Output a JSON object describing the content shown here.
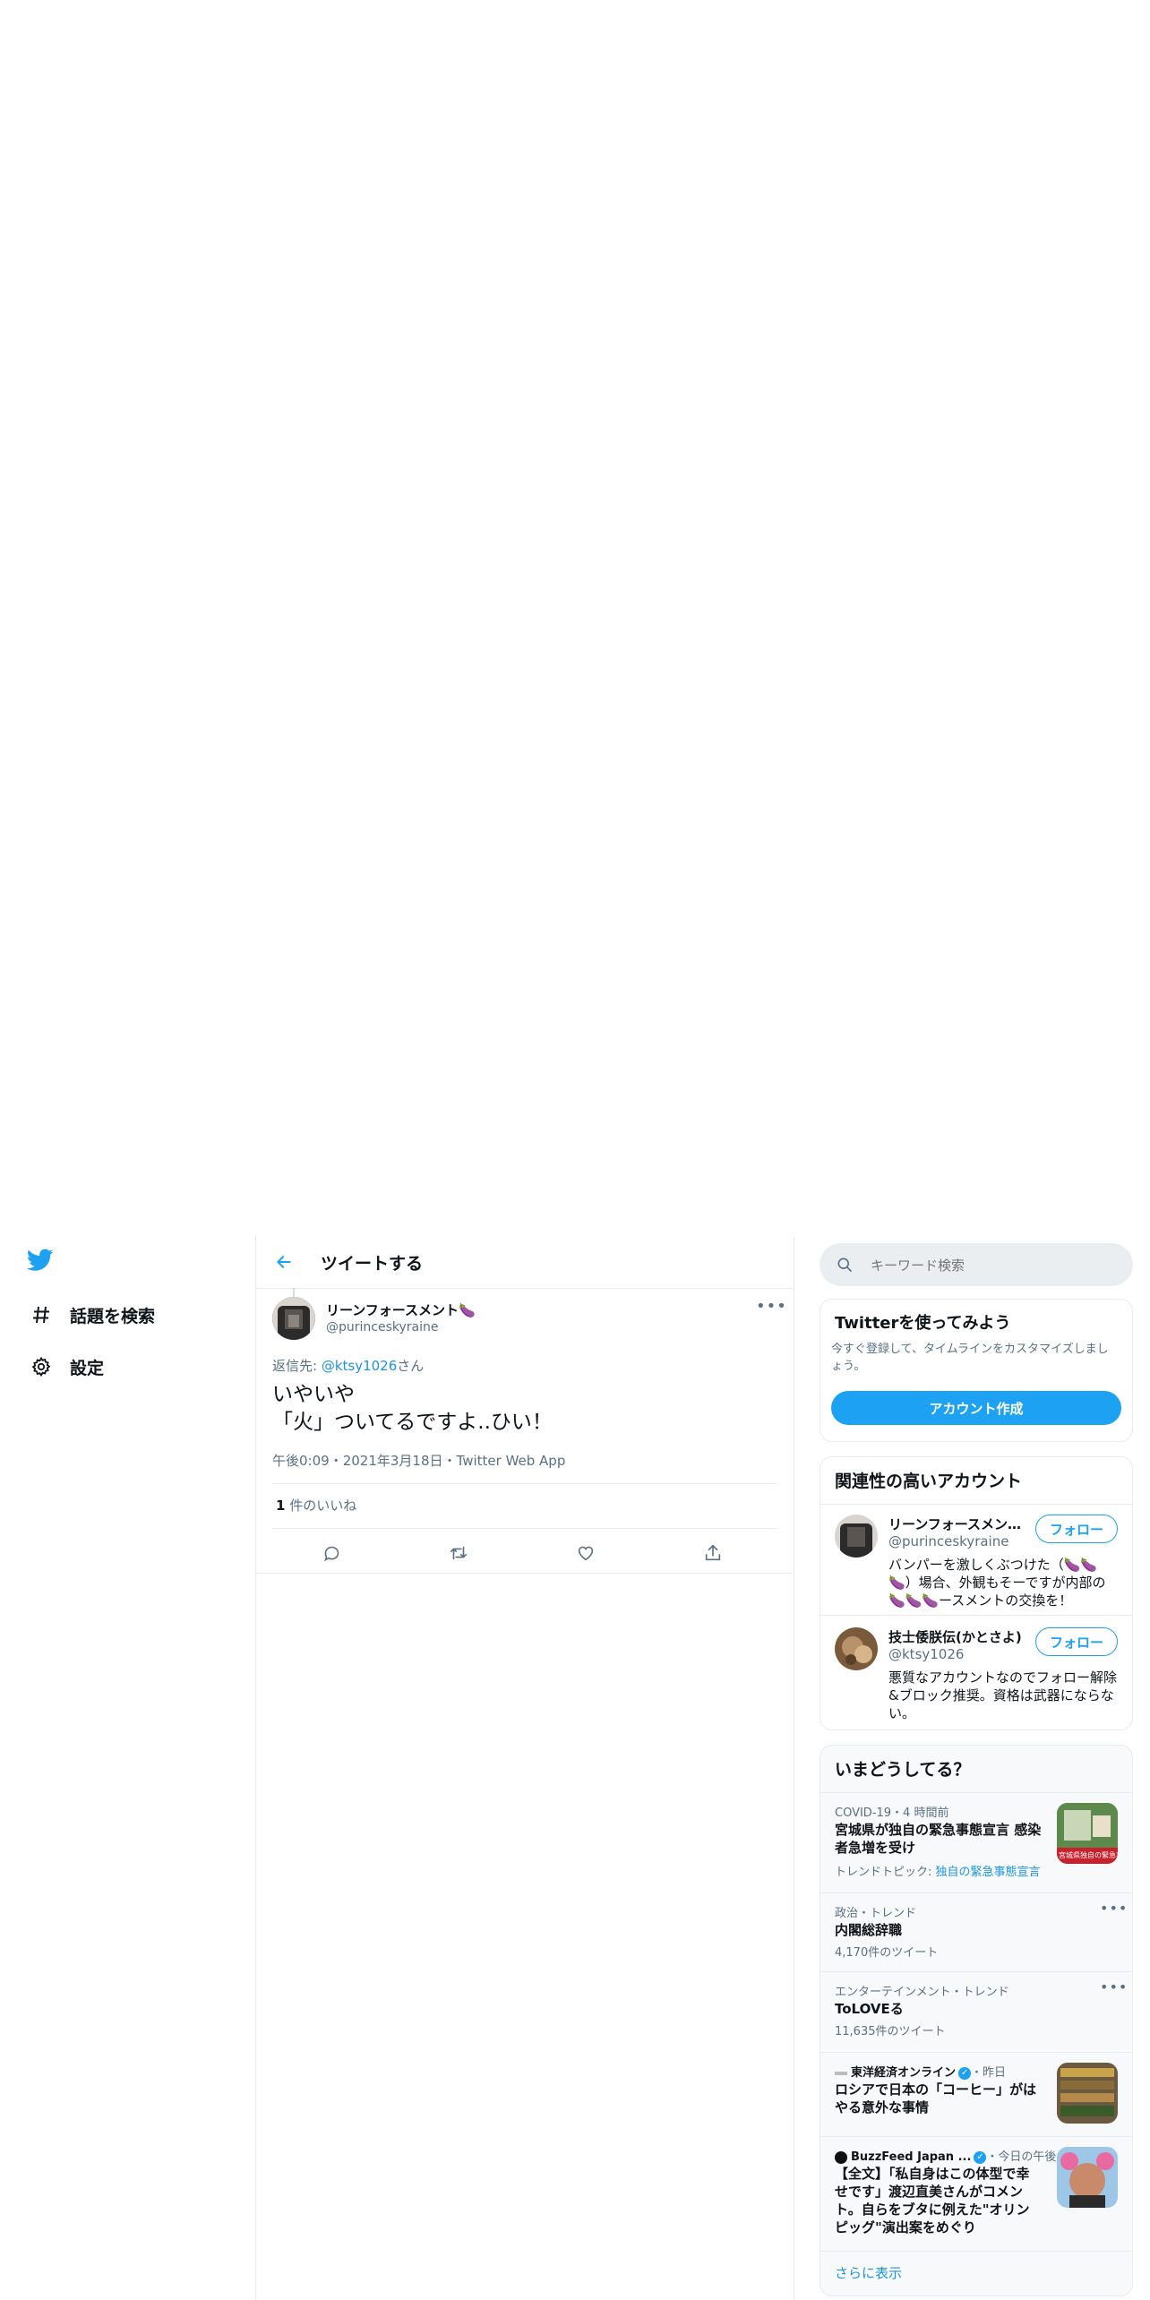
{
  "nav": {
    "items": [
      {
        "label": "話題を検索",
        "icon": "hashtag-icon"
      },
      {
        "label": "設定",
        "icon": "gear-icon"
      }
    ]
  },
  "header": {
    "title": "ツイートする"
  },
  "tweet": {
    "user_name": "リーンフォースメント🍆",
    "user_handle": "@purinceskyraine",
    "reply_prefix": "返信先: ",
    "reply_handle": "@ktsy1026",
    "reply_suffix": "さん",
    "text": "いやいや\n「火」ついてるですよ..ひい！",
    "time": "午後0:09",
    "date": "2021年3月18日",
    "source": "Twitter Web App",
    "like_count": "1",
    "like_label": " 件のいいね"
  },
  "search": {
    "placeholder": "キーワード検索"
  },
  "signup": {
    "title": "Twitterを使ってみよう",
    "desc": "今すぐ登録して、タイムラインをカスタマイズしましょう。",
    "button": "アカウント作成"
  },
  "related": {
    "title": "関連性の高いアカウント",
    "follow_label": "フォロー",
    "accounts": [
      {
        "name": "リーンフォースメン…",
        "handle": "@purinceskyraine",
        "bio": "バンパーを激しくぶつけた（🍆🍆🍆）場合、外観もそーですが内部の🍆🍆🍆ースメントの交換を！"
      },
      {
        "name": "技士倭朕伝(かとさよ)",
        "handle": "@ktsy1026",
        "bio": "悪質なアカウントなのでフォロー解除&ブロック推奨。資格は武器にならない。"
      }
    ]
  },
  "trends": {
    "title": "いまどうしてる？",
    "show_more": "さらに表示",
    "items": [
      {
        "meta": "COVID-19・4 時間前",
        "title": "宮城県が独自の緊急事態宣言 感染者急増を受け",
        "topic_prefix": "トレンドトピック: ",
        "topic": "独自の緊急事態宣言",
        "thumb_text": "宮城県独自の緊急事態"
      },
      {
        "meta": "政治・トレンド",
        "title": "内閣総辞職",
        "count": "4,170件のツイート"
      },
      {
        "meta": "エンターテインメント・トレンド",
        "title": "ToLOVEる",
        "count": "11,635件のツイート"
      },
      {
        "source": "東洋経済オンライン",
        "time": "・昨日",
        "title": "ロシアで日本の「コーヒー」がはやる意外な事情"
      },
      {
        "source": "BuzzFeed Japan ...",
        "time": "・今日の午後",
        "title": "【全文】「私自身はこの体型で幸せです」渡辺直美さんがコメント。自らをブタに例えた\"オリンピッグ\"演出案をめぐり"
      }
    ]
  },
  "colors": {
    "accent": "#1da1f2",
    "text": "#0f1419",
    "muted": "#5b7083",
    "border": "#e6ecf0"
  }
}
